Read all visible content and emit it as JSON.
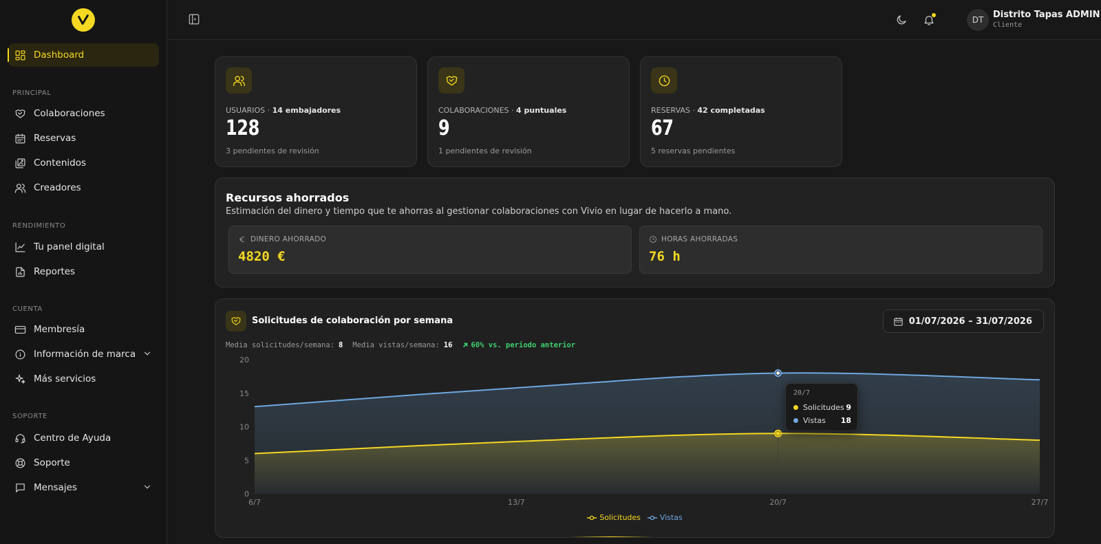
{
  "sidebar": {
    "dashboard": "Dashboard",
    "sections": {
      "principal": "PRINCIPAL",
      "rendimiento": "RENDIMIENTO",
      "cuenta": "CUENTA",
      "soporte": "SOPORTE"
    },
    "items": {
      "colaboraciones": "Colaboraciones",
      "reservas": "Reservas",
      "contenidos": "Contenidos",
      "creadores": "Creadores",
      "panel": "Tu panel digital",
      "reportes": "Reportes",
      "membresia": "Membresía",
      "marca": "Información de marca",
      "servicios": "Más servicios",
      "ayuda": "Centro de Ayuda",
      "soporte": "Soporte",
      "mensajes": "Mensajes"
    }
  },
  "header": {
    "user_initials": "DT",
    "user_name": "Distrito Tapas ADMIN",
    "user_role": "Cliente"
  },
  "stats": [
    {
      "label": "USUARIOS",
      "detail": "14 embajadores",
      "value": "128",
      "sub": "3 pendientes de revisión"
    },
    {
      "label": "COLABORACIONES",
      "detail": "4 puntuales",
      "value": "9",
      "sub": "1 pendientes de revisión"
    },
    {
      "label": "RESERVAS",
      "detail": "42 completadas",
      "value": "67",
      "sub": "5 reservas pendientes"
    }
  ],
  "savings": {
    "title": "Recursos ahorrados",
    "description": "Estimación del dinero y tiempo que te ahorras al gestionar colaboraciones con Vivio en lugar de hacerlo a mano.",
    "money_label": "DINERO AHORRADO",
    "money_value": "4820 €",
    "hours_label": "HORAS AHORRADAS",
    "hours_value": "76 h"
  },
  "chart_panel": {
    "title": "Solicitudes de colaboración por semana",
    "date_range": "01/07/2026 – 31/07/2026",
    "avg_requests_label": "Media solicitudes/semana:",
    "avg_requests_value": "8",
    "avg_views_label": "Media vistas/semana:",
    "avg_views_value": "16",
    "trend": "60% vs. periodo anterior",
    "tooltip": {
      "date": "20/7",
      "solicitudes_label": "Solicitudes",
      "solicitudes_value": "9",
      "vistas_label": "Vistas",
      "vistas_value": "18"
    }
  },
  "colors": {
    "accent": "#f5d821",
    "solicitudes": "#f5d821",
    "vistas": "#6fa8e0",
    "trend_up": "#3ecf6e"
  },
  "chart_data": {
    "type": "area",
    "x": [
      "6/7",
      "13/7",
      "20/7",
      "27/7"
    ],
    "series": [
      {
        "name": "Solicitudes",
        "values": [
          6,
          7.8,
          9,
          8
        ]
      },
      {
        "name": "Vistas",
        "values": [
          13,
          15.8,
          18,
          17
        ]
      }
    ],
    "yticks": [
      0,
      5,
      10,
      15,
      20
    ],
    "ylim": [
      0,
      20
    ],
    "legend": "bottom-center",
    "grid": false
  }
}
